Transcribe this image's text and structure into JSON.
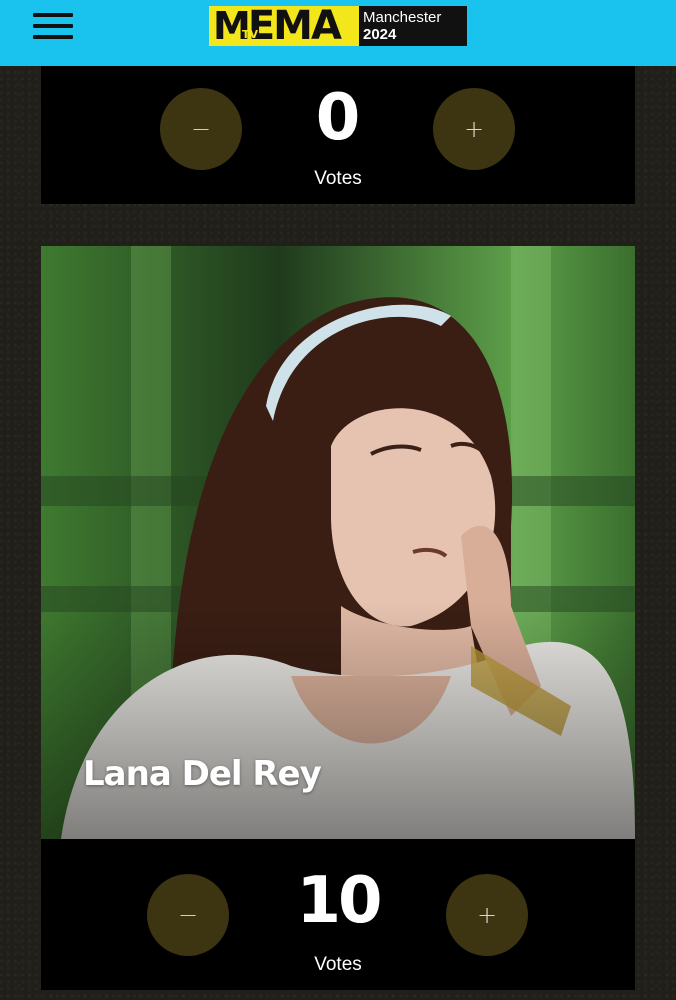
{
  "header": {
    "logo": {
      "mark": "M",
      "tv": "TV",
      "ema": "EMA",
      "city": "Manchester",
      "year": "2024"
    },
    "brand_color": "#19c3ee",
    "logo_color": "#f3e61b"
  },
  "top_vote": {
    "minus_label": "−",
    "plus_label": "+",
    "count": "0",
    "votes_label": "Votes"
  },
  "nominee": {
    "name": "Lana Del Rey",
    "photo": "artist-portrait"
  },
  "bottom_vote": {
    "minus_label": "−",
    "plus_label": "+",
    "count": "10",
    "votes_label": "Votes"
  }
}
